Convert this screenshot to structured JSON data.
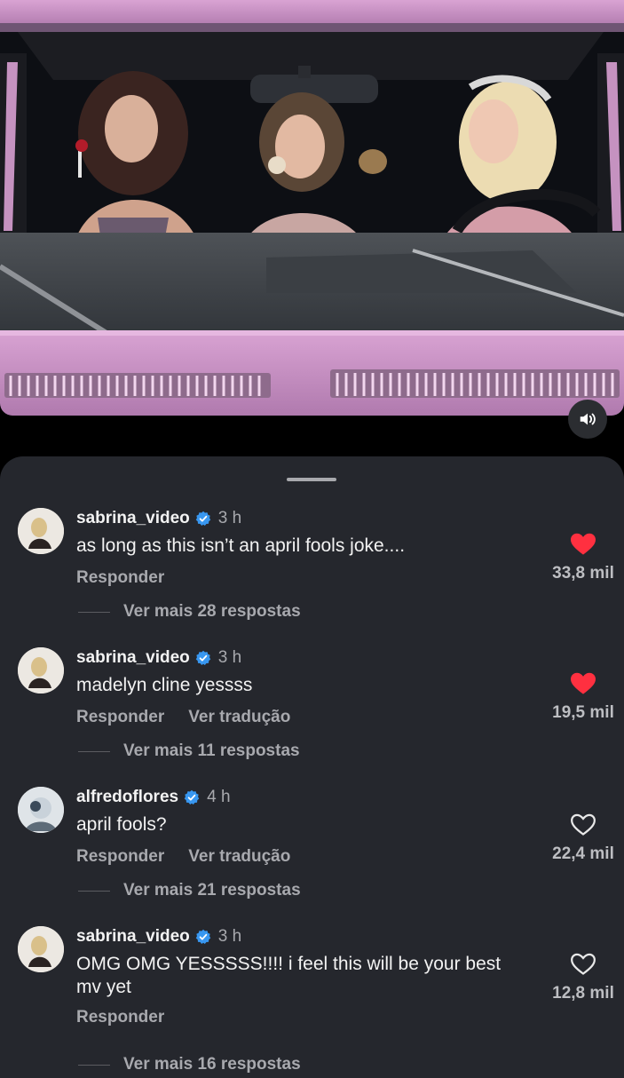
{
  "video": {
    "mute_icon": "speaker-icon"
  },
  "comments": [
    {
      "username": "sabrina_video",
      "time": "3 h",
      "text": "as long as this isn’t an april fools joke....",
      "reply_label": "Responder",
      "translate_label": "",
      "likes": "33,8 mil",
      "liked": true,
      "more_replies": "Ver mais 28 respostas"
    },
    {
      "username": "sabrina_video",
      "time": "3 h",
      "text": "madelyn cline yessss",
      "reply_label": "Responder",
      "translate_label": "Ver tradução",
      "likes": "19,5 mil",
      "liked": true,
      "more_replies": "Ver mais 11 respostas"
    },
    {
      "username": "alfredoflores",
      "time": "4 h",
      "text": "april fools?",
      "reply_label": "Responder",
      "translate_label": "Ver tradução",
      "likes": "22,4 mil",
      "liked": false,
      "more_replies": "Ver mais 21 respostas"
    },
    {
      "username": "sabrina_video",
      "time": "3 h",
      "text": "OMG OMG YESSSSS!!!! i feel this will be your best mv yet",
      "reply_label": "Responder",
      "translate_label": "",
      "likes": "12,8 mil",
      "liked": false,
      "more_replies": "Ver mais 16 respostas"
    }
  ],
  "colors": {
    "liked_heart": "#ff3040",
    "verified_badge": "#3897f0",
    "sheet_bg": "#25272d"
  }
}
